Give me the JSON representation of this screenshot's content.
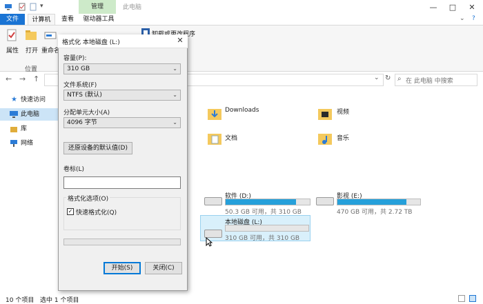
{
  "titlebar": {
    "context_tab": "管理",
    "title": "此电脑",
    "minimize": "—",
    "maximize": "□",
    "close": "✕"
  },
  "tabs": {
    "file": "文件",
    "computer": "计算机",
    "view": "查看",
    "drive_tools": "驱动器工具"
  },
  "ribbon": {
    "properties": "属性",
    "open": "打开",
    "rename": "重命名",
    "uninstall": "卸载或更改程序",
    "group_location": "位置"
  },
  "nav": {
    "back": "←",
    "forward": "→",
    "up": "↑",
    "search_placeholder": "在 此电脑 中搜索",
    "refresh": "↻",
    "search_glyph": "⌕"
  },
  "sidebar": {
    "items": [
      {
        "label": "快速访问"
      },
      {
        "label": "此电脑"
      },
      {
        "label": "库"
      },
      {
        "label": "网络"
      }
    ]
  },
  "folders": [
    {
      "label": "Downloads"
    },
    {
      "label": "视频"
    },
    {
      "label": "文档"
    },
    {
      "label": "音乐"
    }
  ],
  "drives": [
    {
      "name": "软件 (D:)",
      "sub": "50.3 GB 可用，共 310 GB",
      "used_fraction": 0.84
    },
    {
      "name": "影视 (E:)",
      "sub": "470 GB 可用，共 2.72 TB",
      "used_fraction": 0.83
    },
    {
      "name": "本地磁盘 (L:)",
      "sub": "310 GB 可用，共 310 GB",
      "used_fraction": 0.0
    }
  ],
  "status": {
    "count": "10 个项目",
    "selected": "选中 1 个项目"
  },
  "dialog": {
    "title": "格式化 本地磁盘 (L:)",
    "capacity_label": "容量(P):",
    "capacity_value": "310 GB",
    "fs_label": "文件系统(F)",
    "fs_value": "NTFS (默认)",
    "unit_label": "分配单元大小(A)",
    "unit_value": "4096 字节",
    "restore_button": "还原设备的默认值(D)",
    "volume_label": "卷标(L)",
    "volume_value": "",
    "options_label": "格式化选项(O)",
    "quick_format": "快速格式化(Q)",
    "quick_format_checked": "✓",
    "start_button": "开始(S)",
    "close_button": "关闭(C)",
    "close_x": "✕"
  },
  "colors": {
    "accent": "#0078d7",
    "file_tab": "#1a74d4",
    "drive_bar": "#26a0da",
    "context_tab": "#cdeac9",
    "selection": "#cce4f7"
  }
}
